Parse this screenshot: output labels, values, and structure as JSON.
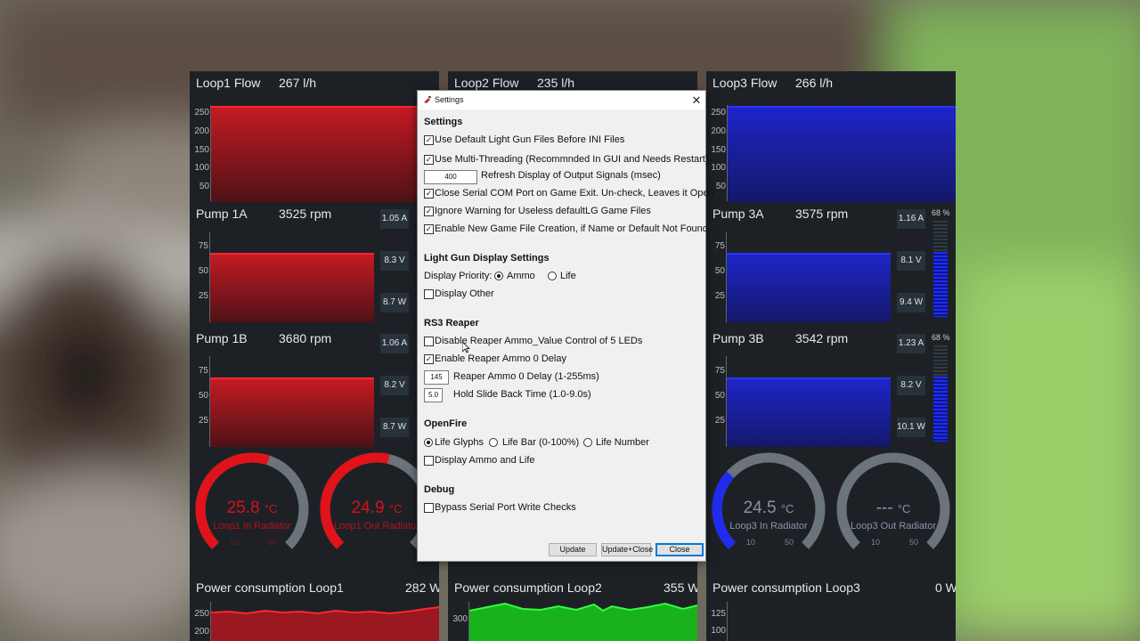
{
  "loops": {
    "loop1_flow": {
      "label": "Loop1 Flow",
      "value": "267 l/h"
    },
    "loop2_flow": {
      "label": "Loop2 Flow",
      "value": "235 l/h"
    },
    "loop3_flow": {
      "label": "Loop3 Flow",
      "value": "266 l/h"
    },
    "flow_ticks": [
      "250",
      "200",
      "150",
      "100",
      "50"
    ]
  },
  "pumps": {
    "p1a": {
      "label": "Pump 1A",
      "rpm": "3525 rpm",
      "amps": "1.05 A",
      "volts": "8.3 V",
      "watts": "8.7 W"
    },
    "p1b": {
      "label": "Pump 1B",
      "rpm": "3680 rpm",
      "amps": "1.06 A",
      "volts": "8.2 V",
      "watts": "8.7 W"
    },
    "p3a": {
      "label": "Pump 3A",
      "rpm": "3575 rpm",
      "amps": "1.16 A",
      "volts": "8.1 V",
      "watts": "9.4 W",
      "pct": "68 %",
      "level": 0.68
    },
    "p3b": {
      "label": "Pump 3B",
      "rpm": "3542 rpm",
      "amps": "1.23 A",
      "volts": "8.2 V",
      "watts": "10.1 W",
      "pct": "68 %",
      "level": 0.68
    },
    "ticks": [
      "75",
      "50",
      "25"
    ]
  },
  "gauges": {
    "g1": {
      "value": "25.8",
      "unit": "°C",
      "label": "Loop1 In Radiator",
      "t1": "10",
      "t2": "50",
      "color": "#e0121a"
    },
    "g2": {
      "value": "24.9",
      "unit": "°C",
      "label": "Loop1 Out Radiator",
      "t1": "10",
      "t2": "50",
      "color": "#e0121a"
    },
    "g3": {
      "value": "24.5",
      "unit": "°C",
      "label": "Loop3 In Radiator",
      "t1": "10",
      "t2": "50",
      "color": "#1f2cf0"
    },
    "g4": {
      "value": "---",
      "unit": "°C",
      "label": "Loop3 Out Radiator",
      "t1": "10",
      "t2": "50",
      "color": "#6c747b"
    }
  },
  "power": {
    "l1": {
      "label": "Power consumption Loop1",
      "value": "282 W",
      "ticks": [
        "250",
        "200"
      ]
    },
    "l2": {
      "label": "Power consumption Loop2",
      "value": "355 W",
      "ticks": [
        "300"
      ]
    },
    "l3": {
      "label": "Power consumption Loop3",
      "value": "0 W",
      "ticks": [
        "125",
        "100"
      ]
    }
  },
  "settings": {
    "title": "Settings",
    "close_glyph": "✕",
    "sections": {
      "general": "Settings",
      "lightgun": "Light Gun Display Settings",
      "rs3": "RS3 Reaper",
      "openfire": "OpenFire",
      "debug": "Debug"
    },
    "opts": {
      "use_default": {
        "label": "Use Default Light Gun Files Before INI Files",
        "checked": true
      },
      "multithread": {
        "label": "Use Multi-Threading (Recommnded In GUI and Needs Restart)",
        "checked": true
      },
      "refresh": {
        "value": "400",
        "label": "Refresh Display of Output Signals (msec)"
      },
      "close_com": {
        "label": "Close Serial COM Port on Game Exit. Un-check, Leaves it Open.",
        "checked": true
      },
      "ignore_warn": {
        "label": "Ignore Warning for Useless defaultLG Game Files",
        "checked": true
      },
      "enable_new": {
        "label": "Enable New Game File Creation, if Name or Default Not Found",
        "checked": true
      },
      "display_priority": "Display Priority:",
      "ammo": "Ammo",
      "life": "Life",
      "display_other": {
        "label": "Display Other",
        "checked": false
      },
      "disable_reaper": {
        "label": "Disable Reaper Ammo_Value Control of 5 LEDs",
        "checked": false
      },
      "enable_reaper": {
        "label": "Enable Reaper Ammo 0 Delay",
        "checked": true
      },
      "reaper_delay": {
        "value": "145",
        "label": "Reaper Ammo 0 Delay (1-255ms)"
      },
      "hold_slide": {
        "value": "5.0",
        "label": "Hold Slide Back Time (1.0-9.0s)"
      },
      "life_glyphs": "Life Glyphs",
      "life_bar": "Life Bar (0-100%)",
      "life_number": "Life Number",
      "display_ammo_life": {
        "label": "Display Ammo and Life",
        "checked": false
      },
      "bypass": {
        "label": "Bypass Serial Port Write Checks",
        "checked": false
      }
    },
    "buttons": {
      "update": "Update",
      "update_close": "Update+Close",
      "close": "Close"
    }
  }
}
